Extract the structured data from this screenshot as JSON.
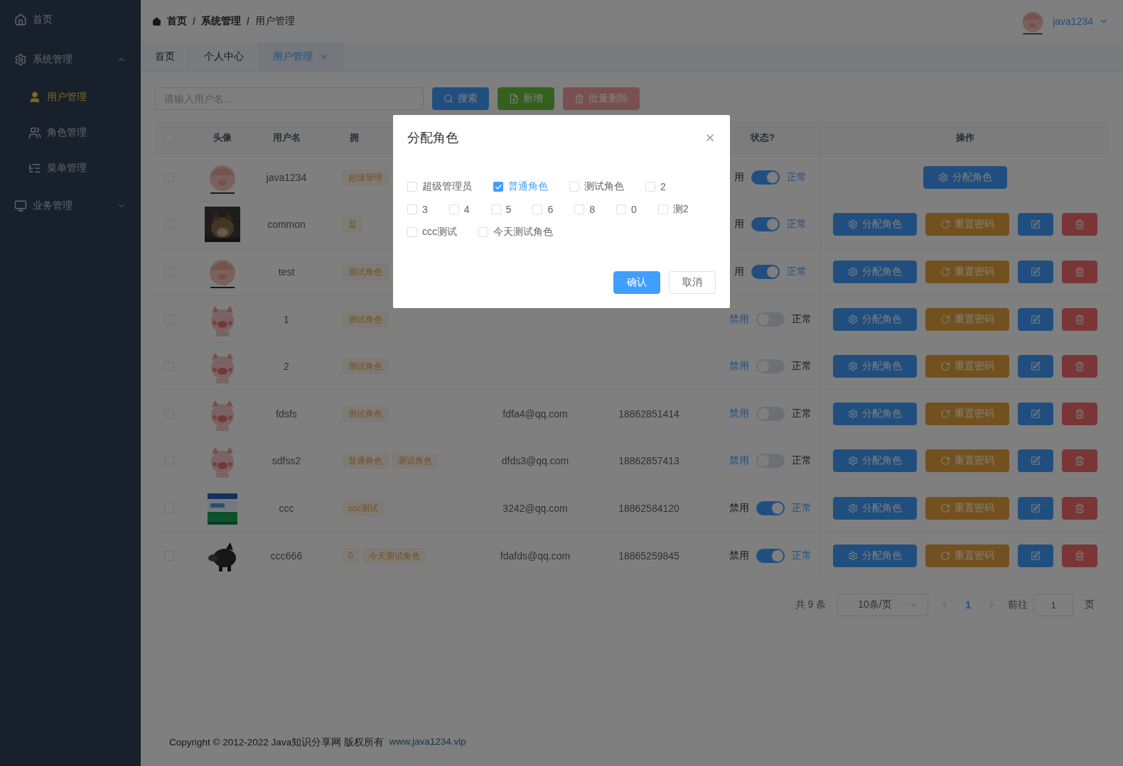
{
  "sidebar": {
    "items": [
      {
        "label": "首页"
      },
      {
        "label": "系统管理",
        "expanded": true,
        "children": [
          {
            "label": "用户管理",
            "selected": true
          },
          {
            "label": "角色管理",
            "selected": false
          },
          {
            "label": "菜单管理",
            "selected": false
          }
        ]
      },
      {
        "label": "业务管理",
        "expanded": false
      }
    ]
  },
  "breadcrumb": {
    "items": [
      "首页",
      "系统管理",
      "用户管理"
    ],
    "separators": [
      "/",
      "/"
    ]
  },
  "user": {
    "name": "java1234"
  },
  "tabs": [
    {
      "label": "首页",
      "selected": false
    },
    {
      "label": "个人中心",
      "selected": false
    },
    {
      "label": "用户管理",
      "selected": true
    }
  ],
  "toolbar": {
    "search": {
      "placeholder": "请输入用户名..."
    },
    "buttons": [
      {
        "kind": "search",
        "label": "搜索",
        "disabled": false
      },
      {
        "kind": "add",
        "label": "新增",
        "disabled": false
      },
      {
        "kind": "batch_delete",
        "label": "批量删除",
        "disabled": true
      }
    ]
  },
  "table": {
    "select_all": {
      "checked": false
    },
    "columns": [
      "头像",
      "用户名",
      "拥",
      "",
      "",
      "状态?",
      "操作"
    ],
    "rows": [
      {
        "checked": false,
        "username": "java1234",
        "roles": [
          "超级管理"
        ],
        "off_label": "用",
        "on": true,
        "on_label": "正常",
        "actions": [
          {
            "kind": "assign",
            "label": "分配角色"
          }
        ]
      },
      {
        "checked": false,
        "username": "common",
        "roles": [
          "普"
        ],
        "off_label": "用",
        "on": true,
        "on_label": "正常",
        "actions": [
          {
            "kind": "assign",
            "label": "分配角色"
          },
          {
            "kind": "reset",
            "label": "重置密码"
          },
          {
            "kind": "edit"
          },
          {
            "kind": "delete"
          }
        ]
      },
      {
        "checked": false,
        "username": "test",
        "roles": [
          "测试角色"
        ],
        "off_label": "用",
        "on": true,
        "on_label": "正常",
        "actions": [
          {
            "kind": "assign",
            "label": "分配角色"
          },
          {
            "kind": "reset",
            "label": "重置密码"
          },
          {
            "kind": "edit"
          },
          {
            "kind": "delete"
          }
        ]
      },
      {
        "checked": false,
        "username": "1",
        "roles": [
          "测试角色"
        ],
        "off_label": "禁用",
        "on": false,
        "on_label": "正常",
        "actions": [
          {
            "kind": "assign",
            "label": "分配角色"
          },
          {
            "kind": "reset",
            "label": "重置密码"
          },
          {
            "kind": "edit"
          },
          {
            "kind": "delete"
          }
        ]
      },
      {
        "checked": false,
        "username": "2",
        "roles": [
          "测试角色"
        ],
        "off_label": "禁用",
        "on": false,
        "on_label": "正常",
        "actions": [
          {
            "kind": "assign",
            "label": "分配角色"
          },
          {
            "kind": "reset",
            "label": "重置密码"
          },
          {
            "kind": "edit"
          },
          {
            "kind": "delete"
          }
        ]
      },
      {
        "checked": false,
        "username": "fdsfs",
        "roles": [
          "测试角色"
        ],
        "email": "fdfa4@qq.com",
        "phone": "18862851414",
        "off_label": "禁用",
        "on": false,
        "on_label": "正常",
        "actions": [
          {
            "kind": "assign",
            "label": "分配角色"
          },
          {
            "kind": "reset",
            "label": "重置密码"
          },
          {
            "kind": "edit"
          },
          {
            "kind": "delete"
          }
        ]
      },
      {
        "checked": false,
        "username": "sdfss2",
        "roles": [
          "普通角色",
          "测试角色"
        ],
        "email": "dfds3@qq.com",
        "phone": "18862857413",
        "off_label": "禁用",
        "on": false,
        "on_label": "正常",
        "actions": [
          {
            "kind": "assign",
            "label": "分配角色"
          },
          {
            "kind": "reset",
            "label": "重置密码"
          },
          {
            "kind": "edit"
          },
          {
            "kind": "delete"
          }
        ]
      },
      {
        "checked": false,
        "username": "ccc",
        "roles": [
          "ccc测试"
        ],
        "email": "3242@qq.com",
        "phone": "18862584120",
        "off_label": "禁用",
        "on": true,
        "on_label": "正常",
        "actions": [
          {
            "kind": "assign",
            "label": "分配角色"
          },
          {
            "kind": "reset",
            "label": "重置密码"
          },
          {
            "kind": "edit"
          },
          {
            "kind": "delete"
          }
        ]
      },
      {
        "checked": false,
        "username": "ccc666",
        "roles": [
          "0",
          "今天测试角色"
        ],
        "email": "fdafds@qq.com",
        "phone": "18865259845",
        "off_label": "禁用",
        "on": true,
        "on_label": "正常",
        "actions": [
          {
            "kind": "assign",
            "label": "分配角色"
          },
          {
            "kind": "reset",
            "label": "重置密码"
          },
          {
            "kind": "edit"
          },
          {
            "kind": "delete"
          }
        ]
      }
    ]
  },
  "pagination": {
    "total": "共 9 条",
    "page_size": "10条/页",
    "pages": [
      {
        "label": "1",
        "selected": true
      }
    ],
    "goto_label": "前往",
    "goto_value": "1",
    "goto_suffix": "页"
  },
  "footer": {
    "copyright": "Copyright © 2012-2022 Java知识分享网 版权所有",
    "link": "www.java1234.vip"
  },
  "dialog": {
    "title": "分配角色",
    "options": [
      {
        "label": "超级管理员",
        "checked": false
      },
      {
        "label": "普通角色",
        "checked": true
      },
      {
        "label": "测试角色",
        "checked": false
      },
      {
        "label": "2",
        "checked": false
      },
      {
        "label": "3",
        "checked": false
      },
      {
        "label": "4",
        "checked": false
      },
      {
        "label": "5",
        "checked": false
      },
      {
        "label": "6",
        "checked": false
      },
      {
        "label": "8",
        "checked": false
      },
      {
        "label": "0",
        "checked": false
      },
      {
        "label": "测2",
        "checked": false
      },
      {
        "label": "ccc测试",
        "checked": false
      },
      {
        "label": "今天测试角色",
        "checked": false
      }
    ],
    "buttons": [
      {
        "kind": "primary",
        "label": "确认"
      },
      {
        "kind": "default",
        "label": "取消"
      }
    ]
  }
}
